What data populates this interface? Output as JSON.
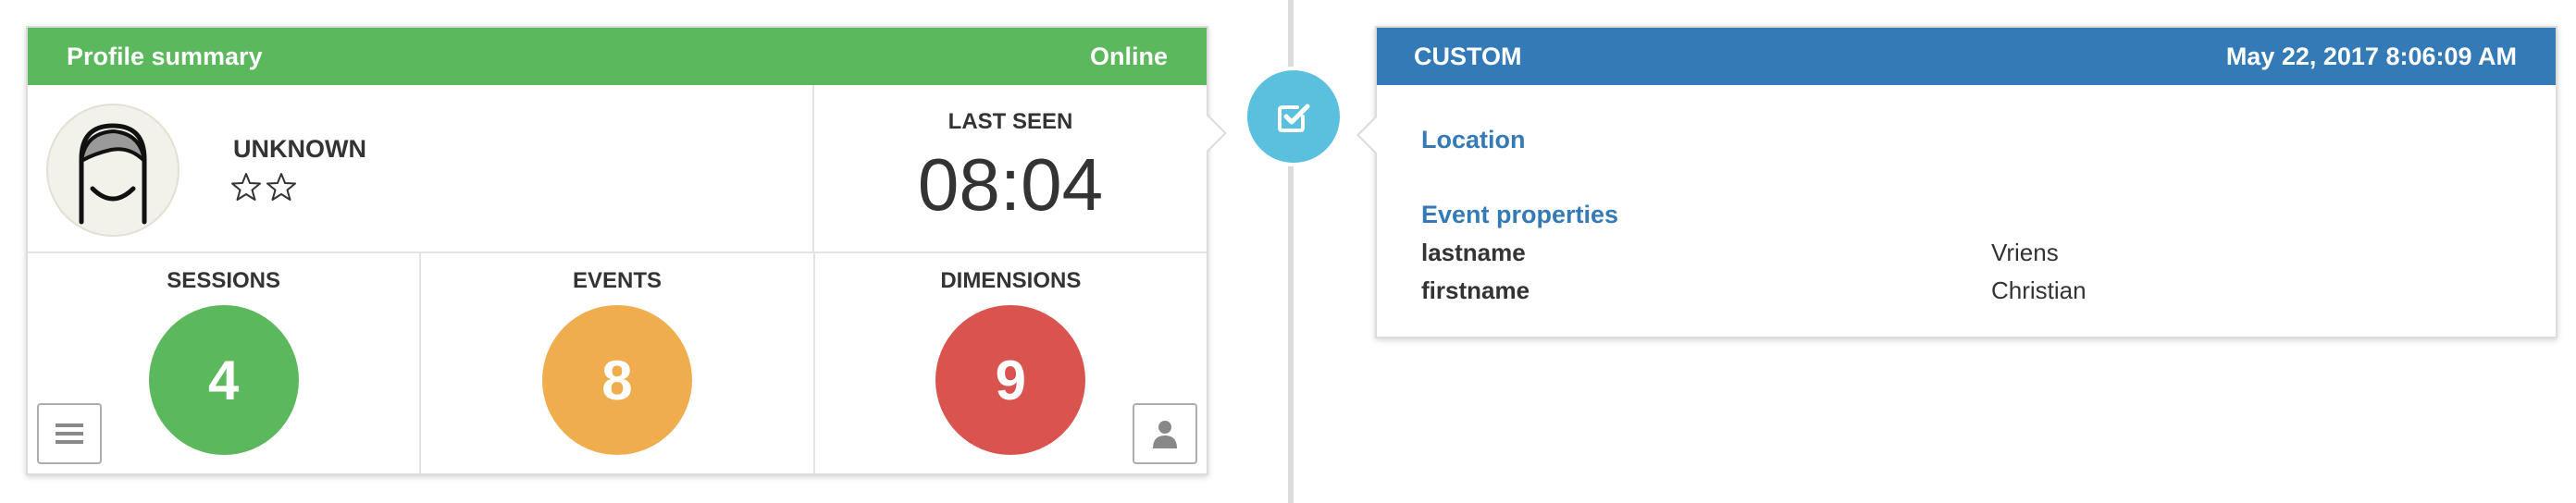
{
  "profile_card": {
    "title": "Profile summary",
    "status": "Online",
    "name": "UNKNOWN",
    "star_rating": {
      "filled": 0,
      "total": 2
    },
    "last_seen_label": "LAST SEEN",
    "last_seen_value": "08:04",
    "stats": [
      {
        "label": "SESSIONS",
        "value": "4",
        "color": "#5cb85c"
      },
      {
        "label": "EVENTS",
        "value": "8",
        "color": "#f0ad4e"
      },
      {
        "label": "DIMENSIONS",
        "value": "9",
        "color": "#d9534f"
      }
    ],
    "header_color": "#5cb85c"
  },
  "timeline_badge": {
    "icon": "check-square-icon",
    "color": "#5bc0de"
  },
  "custom_card": {
    "title": "CUSTOM",
    "timestamp": "May 22, 2017 8:06:09 AM",
    "header_color": "#337ab7",
    "location_title": "Location",
    "event_properties_title": "Event properties",
    "properties": [
      {
        "key": "lastname",
        "value": "Vriens"
      },
      {
        "key": "firstname",
        "value": "Christian"
      }
    ]
  },
  "icons": {
    "menu_button": "menu-icon",
    "user_button": "user-icon"
  }
}
